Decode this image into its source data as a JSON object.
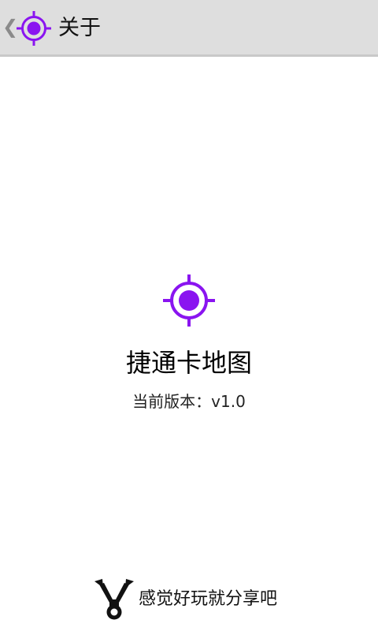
{
  "action_bar": {
    "title": "关于",
    "back_icon": "chevron-left-icon",
    "app_icon": "crosshair-target-icon"
  },
  "about": {
    "app_icon": "crosshair-target-icon",
    "app_name": "捷通卡地图",
    "version_text": "当前版本：v1.0"
  },
  "share": {
    "icon": "slingshot-icon",
    "label": "感觉好玩就分享吧"
  },
  "colors": {
    "accent": "#8a14f0",
    "action_bar_bg": "#dedede",
    "background": "#ffffff"
  }
}
